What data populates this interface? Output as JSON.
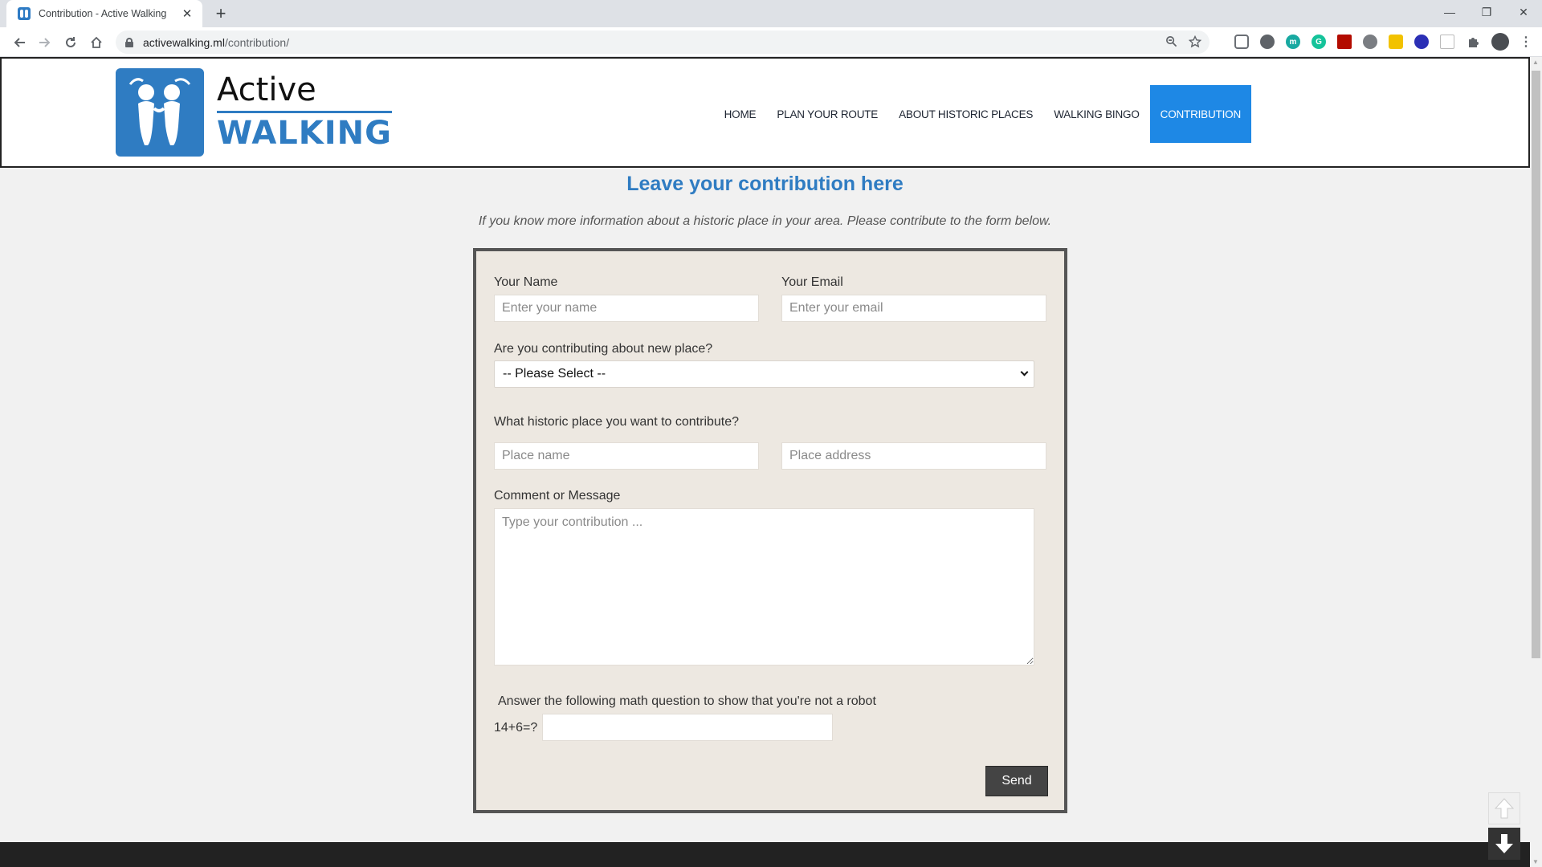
{
  "browser": {
    "tab_title": "Contribution - Active Walking",
    "tab_close": "✕",
    "new_tab": "+",
    "url_domain": "activewalking.ml",
    "url_path": "/contribution/",
    "win_minimize": "—",
    "win_restore": "❐",
    "win_close": "✕"
  },
  "site": {
    "logo_line1": "Active",
    "logo_line2": "WALKING",
    "menu": [
      {
        "label": "HOME"
      },
      {
        "label": "PLAN YOUR ROUTE"
      },
      {
        "label": "ABOUT HISTORIC PLACES"
      },
      {
        "label": "WALKING BINGO"
      },
      {
        "label": "CONTRIBUTION",
        "active": true
      }
    ]
  },
  "content": {
    "title": "Leave your contribution here",
    "intro": "If you know more information about a historic place in your area. Please contribute to the form below."
  },
  "form": {
    "name_label": "Your Name",
    "name_placeholder": "Enter your name",
    "email_label": "Your Email",
    "email_placeholder": "Enter your email",
    "new_place_label": "Are you contributing about new place?",
    "new_place_selected": "-- Please Select --",
    "place_label": "What historic place you want to contribute?",
    "place_name_placeholder": "Place name",
    "place_address_placeholder": "Place address",
    "message_label": "Comment or Message",
    "message_placeholder": "Type your contribution ...",
    "captcha_label": "Answer the following math question to show that you're not a robot",
    "captcha_question": "14+6=?",
    "send_label": "Send"
  },
  "colors": {
    "brand_blue": "#2f7cc2",
    "active_menu": "#1e88e5",
    "form_bg": "#ede8e1"
  }
}
